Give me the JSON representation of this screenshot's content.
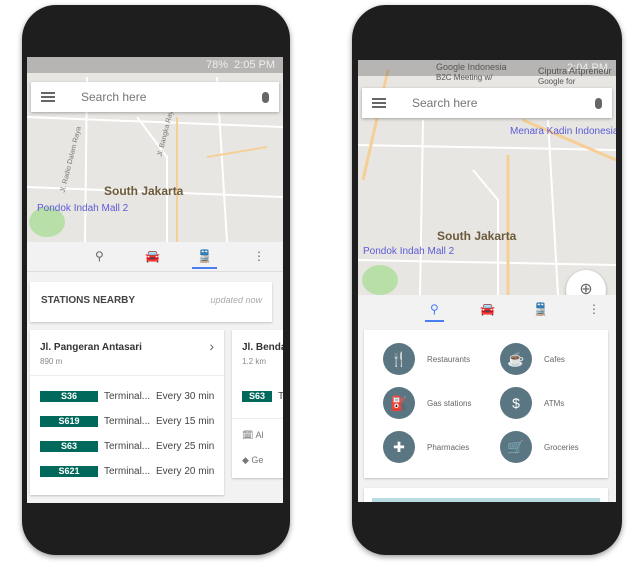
{
  "left": {
    "status": {
      "time": "2:05 PM",
      "battery": "78%"
    },
    "search": {
      "placeholder": "Search here"
    },
    "map": {
      "area": "South Jakarta",
      "poi": "Pondok Indah Mall 2",
      "streets": [
        "Jl. Radio Dalam Raya",
        "Jl. Bangka Raya"
      ]
    },
    "tabs": [
      {
        "icon": "explore-icon"
      },
      {
        "icon": "car-icon"
      },
      {
        "icon": "transit-icon",
        "active": true
      },
      {
        "icon": "more-icon"
      }
    ],
    "stations_header": {
      "title": "STATIONS NEARBY",
      "updated": "updated now"
    },
    "stations": [
      {
        "name": "Jl. Pangeran Antasari",
        "distance": "890 m",
        "routes": [
          {
            "code": "S36",
            "dest": "Terminal...",
            "freq": "Every 30 min"
          },
          {
            "code": "S619",
            "dest": "Terminal...",
            "freq": "Every 15 min"
          },
          {
            "code": "S63",
            "dest": "Terminal...",
            "freq": "Every 25 min"
          },
          {
            "code": "S621",
            "dest": "Terminal...",
            "freq": "Every 20 min"
          }
        ]
      },
      {
        "name": "Jl. Benda",
        "distance": "1.2 km",
        "routes": [
          {
            "code": "S63",
            "dest": "T"
          }
        ],
        "actions": [
          "Al",
          "Ge"
        ]
      }
    ],
    "accent": "#00695c"
  },
  "right": {
    "status": {
      "time": "2:04 PM"
    },
    "search": {
      "placeholder": "Search here"
    },
    "map": {
      "area": "South Jakarta",
      "poi": "Pondok Indah Mall 2",
      "poi2": "Menara Kadin Indonesia",
      "top_labels": [
        "Google Indonesia",
        "B2C Meeting w/",
        "Ciputra Artpreneur",
        "Google for"
      ]
    },
    "tabs": [
      {
        "icon": "explore-icon",
        "active": true
      },
      {
        "icon": "car-icon"
      },
      {
        "icon": "transit-icon"
      },
      {
        "icon": "more-icon"
      }
    ],
    "categories": [
      {
        "label": "Restaurants",
        "icon": "restaurant-icon"
      },
      {
        "label": "Cafes",
        "icon": "cafe-icon"
      },
      {
        "label": "Gas stations",
        "icon": "gas-station-icon"
      },
      {
        "label": "ATMs",
        "icon": "atm-icon"
      },
      {
        "label": "Pharmacies",
        "icon": "pharmacy-icon"
      },
      {
        "label": "Groceries",
        "icon": "grocery-icon"
      }
    ],
    "category_color": "#5a7683",
    "accent": "#4a7df0"
  }
}
